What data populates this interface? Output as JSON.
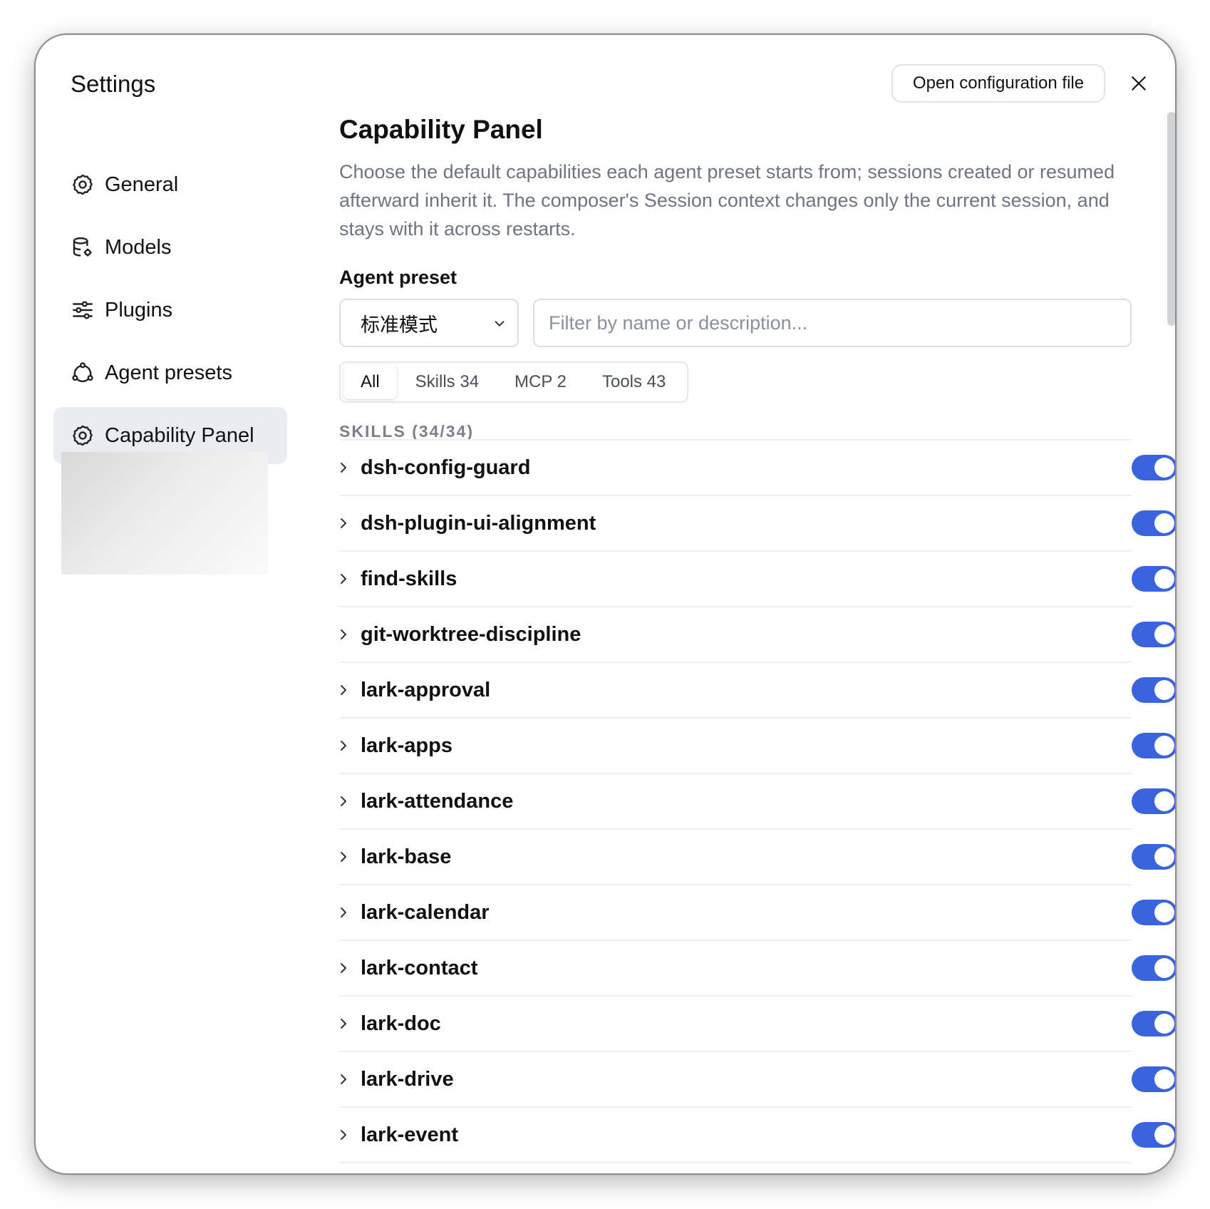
{
  "window": {
    "title": "Settings",
    "open_config_label": "Open configuration file"
  },
  "sidebar": {
    "items": [
      {
        "label": "General",
        "icon": "gear-icon"
      },
      {
        "label": "Models",
        "icon": "database-gear-icon"
      },
      {
        "label": "Plugins",
        "icon": "sliders-icon"
      },
      {
        "label": "Agent presets",
        "icon": "agent-cycle-icon"
      },
      {
        "label": "Capability Panel",
        "icon": "gear-icon",
        "active": true
      }
    ]
  },
  "main": {
    "title": "Capability Panel",
    "description": "Choose the default capabilities each agent preset starts from; sessions created or resumed afterward inherit it. The composer's Session context changes only the current session, and stays with it across restarts.",
    "preset_label": "Agent preset",
    "preset_value": "标准模式",
    "filter_placeholder": "Filter by name or description...",
    "tabs": [
      {
        "label": "All",
        "active": true
      },
      {
        "label": "Skills 34"
      },
      {
        "label": "MCP 2"
      },
      {
        "label": "Tools 43"
      }
    ],
    "section_header": "SKILLS (34/34)",
    "skills": [
      {
        "name": "dsh-config-guard",
        "enabled": true
      },
      {
        "name": "dsh-plugin-ui-alignment",
        "enabled": true
      },
      {
        "name": "find-skills",
        "enabled": true
      },
      {
        "name": "git-worktree-discipline",
        "enabled": true
      },
      {
        "name": "lark-approval",
        "enabled": true
      },
      {
        "name": "lark-apps",
        "enabled": true
      },
      {
        "name": "lark-attendance",
        "enabled": true
      },
      {
        "name": "lark-base",
        "enabled": true
      },
      {
        "name": "lark-calendar",
        "enabled": true
      },
      {
        "name": "lark-contact",
        "enabled": true
      },
      {
        "name": "lark-doc",
        "enabled": true
      },
      {
        "name": "lark-drive",
        "enabled": true
      },
      {
        "name": "lark-event",
        "enabled": true
      }
    ]
  },
  "colors": {
    "accent": "#3a63e0",
    "active_nav_bg": "#e9ecf1",
    "muted_text": "#6e7480"
  }
}
